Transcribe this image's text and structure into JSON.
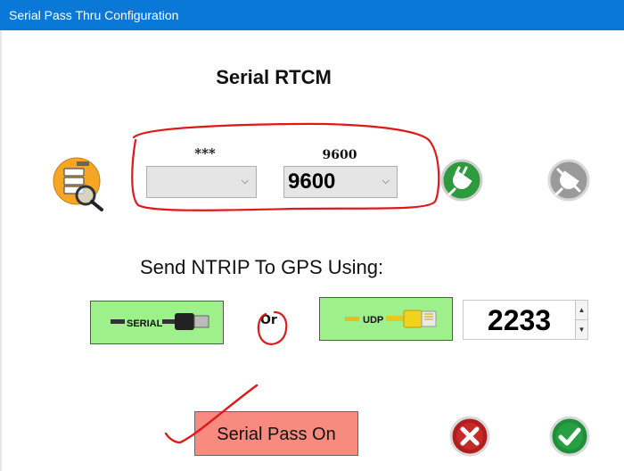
{
  "window": {
    "title": "Serial Pass Thru Configuration"
  },
  "heading": "Serial RTCM",
  "port": {
    "label": "***",
    "selected": ""
  },
  "baud": {
    "label": "9600",
    "selected": "9600"
  },
  "send": {
    "label": "Send NTRIP To GPS Using:",
    "serial_label": "SERIAL",
    "or_label": "Or",
    "udp_label": "UDP",
    "udp_port": "2233"
  },
  "pass_button": "Serial Pass On",
  "colors": {
    "titlebar": "#0a78d7",
    "mode_button": "#9ef08a",
    "pass_button": "#f88a80",
    "annotation": "#e01818"
  },
  "icons": {
    "port_search": "usb-search-icon",
    "connect": "plug-connect-icon",
    "disconnect": "plug-disconnect-icon",
    "cancel": "cancel-x-icon",
    "ok": "checkmark-icon"
  }
}
